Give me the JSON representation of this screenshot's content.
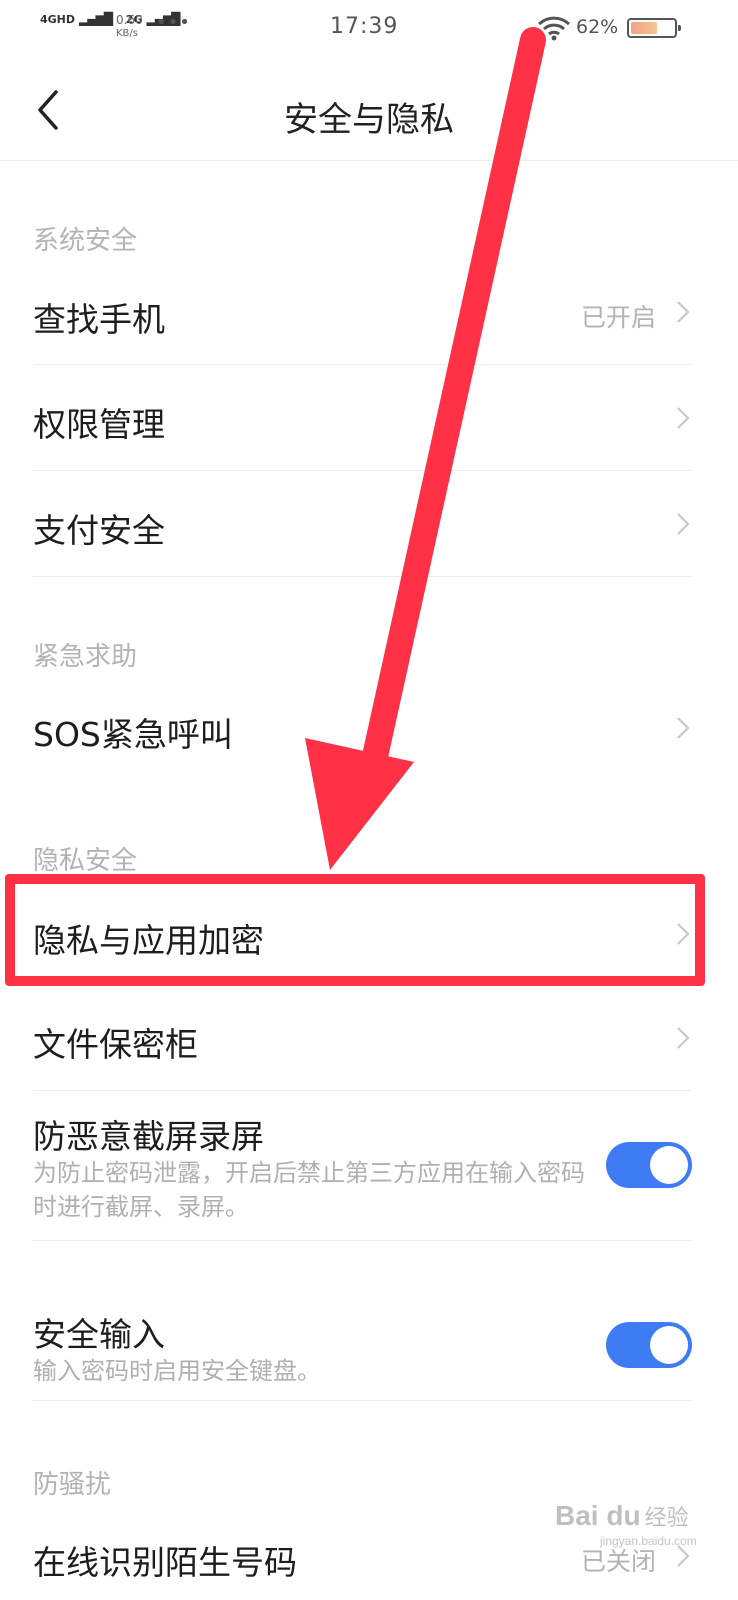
{
  "status_bar": {
    "network_1": "4GHD",
    "network_2": "2G",
    "speed_value": "0.60",
    "speed_unit": "KB/s",
    "more": "•••",
    "time": "17:39",
    "battery_percent": "62%",
    "battery_level": 0.62
  },
  "header": {
    "title": "安全与隐私",
    "back_icon": "chevron-left-icon"
  },
  "sections": {
    "system_security": {
      "title": "系统安全",
      "items": [
        {
          "label": "查找手机",
          "value": "已开启"
        },
        {
          "label": "权限管理",
          "value": ""
        },
        {
          "label": "支付安全",
          "value": ""
        }
      ]
    },
    "emergency": {
      "title": "紧急求助",
      "items": [
        {
          "label": "SOS紧急呼叫",
          "value": ""
        }
      ]
    },
    "privacy_security": {
      "title": "隐私安全",
      "items": [
        {
          "label": "隐私与应用加密",
          "value": "",
          "highlighted": true
        },
        {
          "label": "文件保密柜",
          "value": ""
        },
        {
          "label": "防恶意截屏录屏",
          "description": "为防止密码泄露，开启后禁止第三方应用在输入密码时进行截屏、录屏。",
          "toggle_on": true
        },
        {
          "label": "安全输入",
          "description": "输入密码时启用安全键盘。",
          "toggle_on": true
        }
      ]
    },
    "anti_harassment": {
      "title": "防骚扰",
      "items": [
        {
          "label": "在线识别陌生号码",
          "value": "已关闭"
        }
      ]
    }
  },
  "annotation": {
    "color": "#ff3146"
  },
  "colors": {
    "toggle_on": "#3f7cf4",
    "section_title": "#b3b3b3"
  },
  "watermark": {
    "brand": "Bai du",
    "cn": "经验",
    "sub": "jingyan.baidu.com"
  }
}
